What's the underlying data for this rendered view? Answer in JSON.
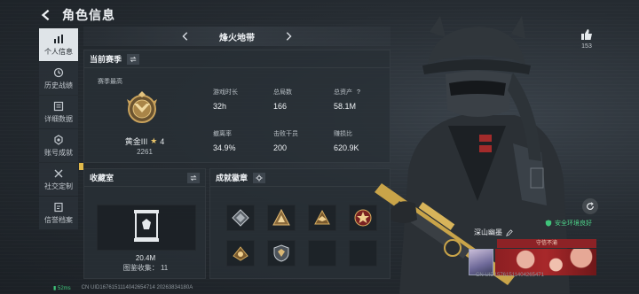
{
  "header": {
    "title": "角色信息"
  },
  "nav": {
    "items": [
      {
        "label": "个人信息",
        "icon": "bar-chart-icon",
        "active": true
      },
      {
        "label": "历史战绩",
        "icon": "history-icon",
        "active": false
      },
      {
        "label": "详细数据",
        "icon": "detail-data-icon",
        "active": false
      },
      {
        "label": "账号成就",
        "icon": "achievement-icon",
        "active": false
      },
      {
        "label": "社交定制",
        "icon": "social-custom-icon",
        "active": false
      },
      {
        "label": "信誉档案",
        "icon": "credit-record-icon",
        "active": false
      }
    ]
  },
  "season_bar": {
    "name": "烽火地带"
  },
  "current_season": {
    "title": "当前赛季",
    "best_label": "赛季最高",
    "rank_name": "黄金III",
    "rank_stars": "4",
    "rank_score": "2261",
    "stats": [
      {
        "label": "游戏时长",
        "value": "32h"
      },
      {
        "label": "总局数",
        "value": "166"
      },
      {
        "label": "总资产",
        "value": "58.1M",
        "help": "?"
      },
      {
        "label": "撤离率",
        "value": "34.9%"
      },
      {
        "label": "击败干员",
        "value": "200"
      },
      {
        "label": "赚损比",
        "value": "620.9K"
      }
    ]
  },
  "collection": {
    "title": "收藏室",
    "value": "20.4M",
    "count_text": "图鉴收集： 11"
  },
  "achievements": {
    "title": "成就徽章"
  },
  "likes": {
    "count": "153"
  },
  "environment": {
    "status": "安全环境良好"
  },
  "player": {
    "name": "深山幽墨",
    "tag": "守信不渝"
  },
  "footer": {
    "latency": "52ms",
    "id_text": "CN UID1676151114042654714 20263834180A"
  },
  "id_overlay": "CN UID15761511404265471"
}
